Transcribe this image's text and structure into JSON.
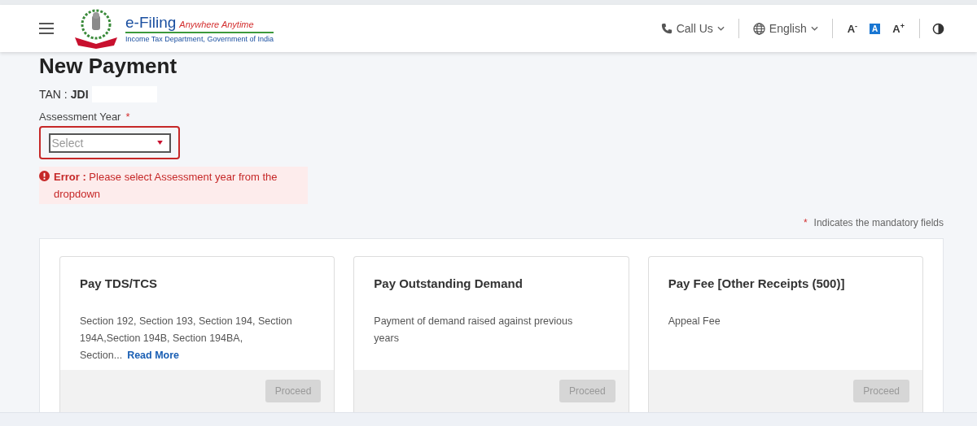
{
  "header": {
    "logo": {
      "brand": "e-Filing",
      "tagline": "Anywhere Anytime",
      "subtitle": "Income Tax Department, Government of India"
    },
    "call_us": "Call Us",
    "language": "English",
    "font_sizes": [
      {
        "letter": "A",
        "sign": "-",
        "selected": false
      },
      {
        "letter": "A",
        "selected": true
      },
      {
        "letter": "A",
        "sign": "+",
        "selected": false
      }
    ]
  },
  "page": {
    "title": "New Payment",
    "tan_label": "TAN :",
    "tan_value": "JDI",
    "assessment_year": {
      "label": "Assessment Year",
      "required_mark": "*",
      "placeholder": "Select",
      "invalid": true
    },
    "error": {
      "prefix": "Error :",
      "message": "Please select Assessment year from the dropdown"
    },
    "mandatory_note": {
      "mark": "*",
      "text": "Indicates the mandatory fields"
    }
  },
  "cards": [
    {
      "title": "Pay TDS/TCS",
      "description": "Section 192, Section 193, Section 194, Section 194A,Section 194B, Section 194BA, Section...",
      "link": "Read More",
      "button": "Proceed",
      "disabled": true
    },
    {
      "title": "Pay Outstanding Demand",
      "description": "Payment of demand raised against previous years",
      "button": "Proceed",
      "disabled": true
    },
    {
      "title": "Pay Fee [Other Receipts (500)]",
      "description": "Appeal Fee",
      "button": "Proceed",
      "disabled": true
    }
  ]
}
